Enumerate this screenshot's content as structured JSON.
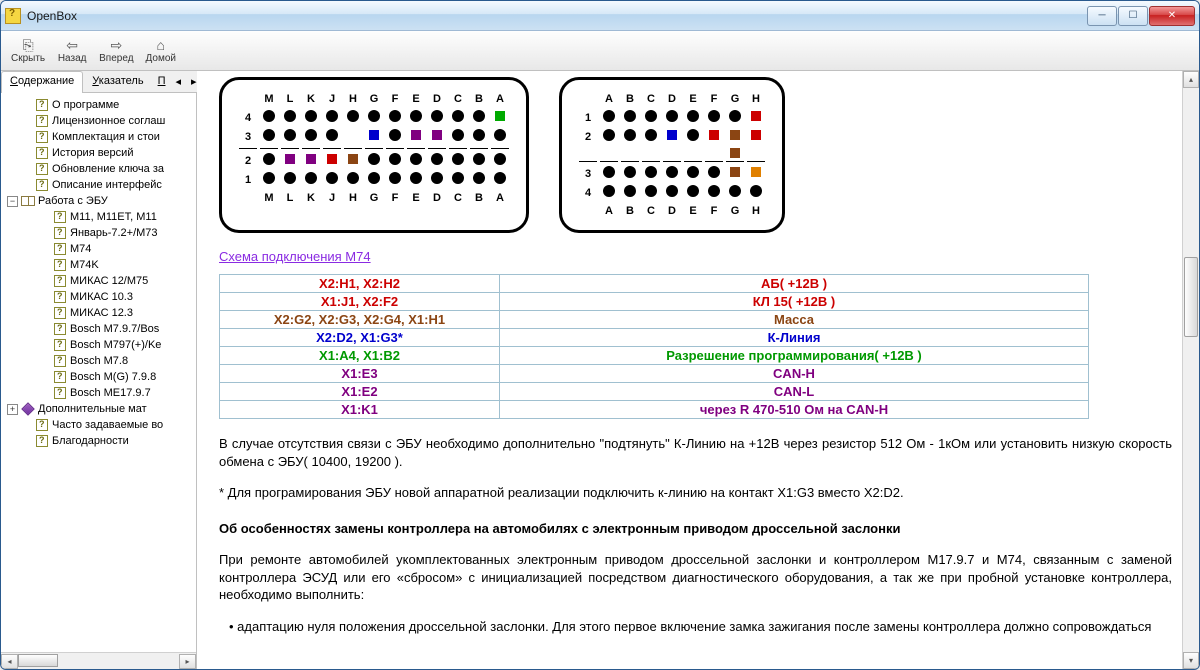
{
  "window": {
    "title": "OpenBox"
  },
  "toolbar": {
    "hide": "Скрыть",
    "back": "Назад",
    "forward": "Вперед",
    "home": "Домой"
  },
  "tabs": {
    "contents": "одержание",
    "contents_u": "С",
    "index": "казатель",
    "index_u": "У",
    "p": "П"
  },
  "tree": {
    "items": [
      {
        "label": "О программе",
        "icon": "help",
        "level": 1
      },
      {
        "label": "Лицензионное соглаш",
        "icon": "help",
        "level": 1
      },
      {
        "label": "Комплектация и стои",
        "icon": "help",
        "level": 1
      },
      {
        "label": "История версий",
        "icon": "help",
        "level": 1
      },
      {
        "label": "Обновление ключа за",
        "icon": "help",
        "level": 1
      },
      {
        "label": "Описание интерфейс",
        "icon": "help",
        "level": 1
      },
      {
        "label": "Работа с ЭБУ",
        "icon": "book-open",
        "level": 0,
        "exp": "−"
      },
      {
        "label": "M11, M11ET, M11",
        "icon": "help",
        "level": 2
      },
      {
        "label": "Январь-7.2+/M73",
        "icon": "help",
        "level": 2
      },
      {
        "label": "M74",
        "icon": "help",
        "level": 2
      },
      {
        "label": "M74K",
        "icon": "help",
        "level": 2
      },
      {
        "label": "МИКАС 12/M75",
        "icon": "help",
        "level": 2
      },
      {
        "label": "МИКАС 10.3",
        "icon": "help",
        "level": 2
      },
      {
        "label": "МИКАС 12.3",
        "icon": "help",
        "level": 2
      },
      {
        "label": "Bosch M7.9.7/Bos",
        "icon": "help",
        "level": 2
      },
      {
        "label": "Bosch M797(+)/Ke",
        "icon": "help",
        "level": 2
      },
      {
        "label": "Bosch M7.8",
        "icon": "help",
        "level": 2
      },
      {
        "label": "Bosch M(G) 7.9.8",
        "icon": "help",
        "level": 2
      },
      {
        "label": "Bosch ME17.9.7",
        "icon": "help",
        "level": 2
      },
      {
        "label": "Дополнительные мат",
        "icon": "purple",
        "level": 0,
        "exp": "+"
      },
      {
        "label": "Часто задаваемые во",
        "icon": "help",
        "level": 1
      },
      {
        "label": "Благодарности",
        "icon": "help",
        "level": 1
      }
    ]
  },
  "content": {
    "link": "Схема подключения M74",
    "conn1_cols": [
      "M",
      "L",
      "K",
      "J",
      "H",
      "G",
      "F",
      "E",
      "D",
      "C",
      "B",
      "A"
    ],
    "conn1_rows": [
      "4",
      "3",
      "2",
      "1"
    ],
    "conn2_cols": [
      "A",
      "B",
      "C",
      "D",
      "E",
      "F",
      "G",
      "H"
    ],
    "conn2_rows": [
      "1",
      "2",
      "3",
      "4"
    ],
    "table": [
      {
        "pin": "X2:H1, X2:H2",
        "desc": "АБ( +12В )",
        "color": "c-red"
      },
      {
        "pin": "X1:J1, X2:F2",
        "desc": "КЛ 15( +12В )",
        "color": "c-red"
      },
      {
        "pin": "X2:G2, X2:G3, X2:G4, X1:H1",
        "desc": "Масса",
        "color": "c-brown"
      },
      {
        "pin": "X2:D2, X1:G3*",
        "desc": "К-Линия",
        "color": "c-blue"
      },
      {
        "pin": "X1:A4, X1:B2",
        "desc": "Разрешение программирования( +12В )",
        "color": "c-green"
      },
      {
        "pin": "X1:E3",
        "desc": "CAN-H",
        "color": "c-purple"
      },
      {
        "pin": "X1:E2",
        "desc": "CAN-L",
        "color": "c-purple"
      },
      {
        "pin": "X1:K1",
        "desc": "через R 470-510 Ом на CAN-H",
        "color": "c-purple"
      }
    ],
    "para1": "В случае отсутствия связи с ЭБУ необходимо дополнительно \"подтянуть\" К-Линию на +12В через резистор 512 Ом - 1кОм или установить низкую скорость обмена с ЭБУ( 10400, 19200 ).",
    "para2": "* Для програмирования ЭБУ новой аппаратной реализации подключить к-линию на контакт X1:G3 вместо X2:D2.",
    "heading": "Об особенностях замены контроллера на автомобилях с электронным приводом дроссельной заслонки",
    "para3": "При ремонте автомобилей укомплектованных электронным приводом дроссельной заслонки и контроллером М17.9.7 и М74, связанным с заменой контроллера ЭСУД или его «сбросом» с инициализацией посредством диагностического оборудования, а так же при пробной установке контроллера, необходимо выполнить:",
    "para4": "• адаптацию нуля положения дроссельной заслонки. Для этого первое включение замка зажигания после замены контроллера должно сопровождаться"
  }
}
